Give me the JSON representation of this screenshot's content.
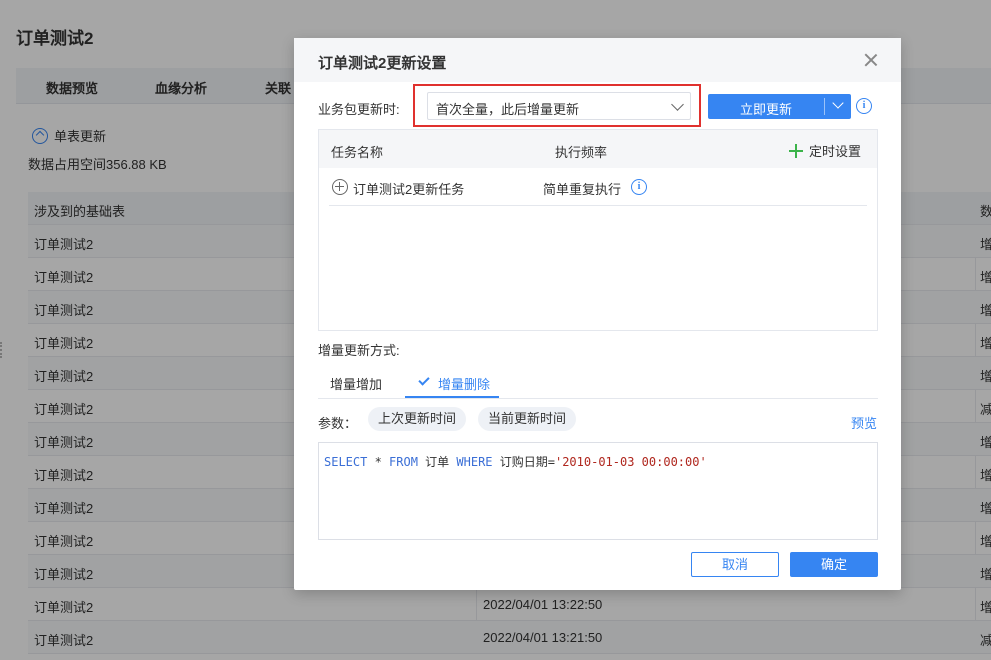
{
  "background": {
    "page_title": "订单测试2",
    "tabs": [
      "数据预览",
      "血缘分析",
      "关联"
    ],
    "update_label": "单表更新",
    "space_text": "数据占用空间356.88 KB",
    "table": {
      "header": [
        "涉及到的基础表",
        "",
        "数"
      ],
      "rows": [
        [
          "订单测试2",
          "",
          "增"
        ],
        [
          "订单测试2",
          "",
          "增"
        ],
        [
          "订单测试2",
          "",
          "增"
        ],
        [
          "订单测试2",
          "",
          "增"
        ],
        [
          "订单测试2",
          "",
          "增"
        ],
        [
          "订单测试2",
          "",
          "减"
        ],
        [
          "订单测试2",
          "",
          "增"
        ],
        [
          "订单测试2",
          "",
          "增"
        ],
        [
          "订单测试2",
          "",
          "增"
        ],
        [
          "订单测试2",
          "",
          "增"
        ],
        [
          "订单测试2",
          "",
          "增"
        ],
        [
          "订单测试2",
          "2022/04/01 13:22:50",
          "增"
        ],
        [
          "订单测试2",
          "2022/04/01 13:21:50",
          "减"
        ]
      ]
    }
  },
  "dialog": {
    "title": "订单测试2更新设置",
    "update_label": "业务包更新时:",
    "update_mode": "首次全量，此后增量更新",
    "update_now_label": "立即更新",
    "task_table": {
      "col_name": "任务名称",
      "col_freq": "执行频率",
      "timer_label": "定时设置",
      "rows": [
        {
          "name": "订单测试2更新任务",
          "freq": "简单重复执行"
        }
      ]
    },
    "increment_label": "增量更新方式:",
    "increment_tabs": [
      "增量增加",
      "增量删除"
    ],
    "active_increment_tab": "增量删除",
    "params_label": "参数：",
    "params": [
      "上次更新时间",
      "当前更新时间"
    ],
    "preview_label": "预览",
    "sql": {
      "kw_select": "SELECT",
      "star": " * ",
      "kw_from": "FROM",
      "table": " 订单 ",
      "kw_where": "WHERE",
      "cond": " 订购日期=",
      "value": "'2010-01-03 00:00:00'"
    },
    "cancel_label": "取消",
    "ok_label": "确定"
  }
}
